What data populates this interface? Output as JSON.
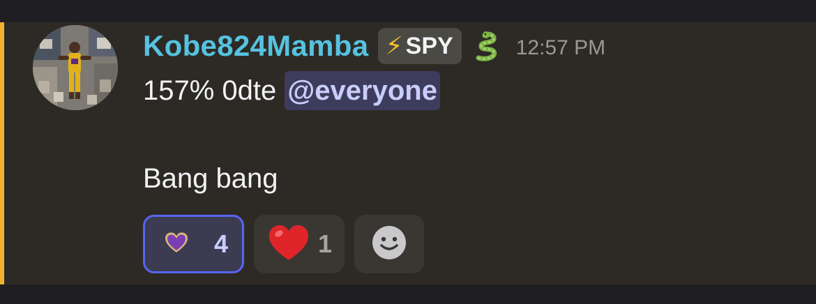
{
  "message": {
    "author": "Kobe824Mamba",
    "role_tag": {
      "icon": "lightning-bolt-icon",
      "bolt_glyph": "⚡",
      "label": "SPY"
    },
    "author_icon": "snake-icon",
    "timestamp": "12:57 PM",
    "line1_text": "157% 0dte",
    "mention": "@everyone",
    "line2_text": "Bang bang"
  },
  "reactions": [
    {
      "emoji": "purple-heart-icon",
      "count": "4",
      "active": true
    },
    {
      "emoji": "red-heart-icon",
      "count": "1",
      "active": false
    },
    {
      "emoji": "add-reaction-icon",
      "count": "",
      "active": false
    }
  ],
  "colors": {
    "username": "#56c2e0",
    "highlight_bar": "#f0b232",
    "mention_bg": "#3e3c5c",
    "mention_text": "#c9cdfb",
    "active_reaction_border": "#5865f2"
  }
}
